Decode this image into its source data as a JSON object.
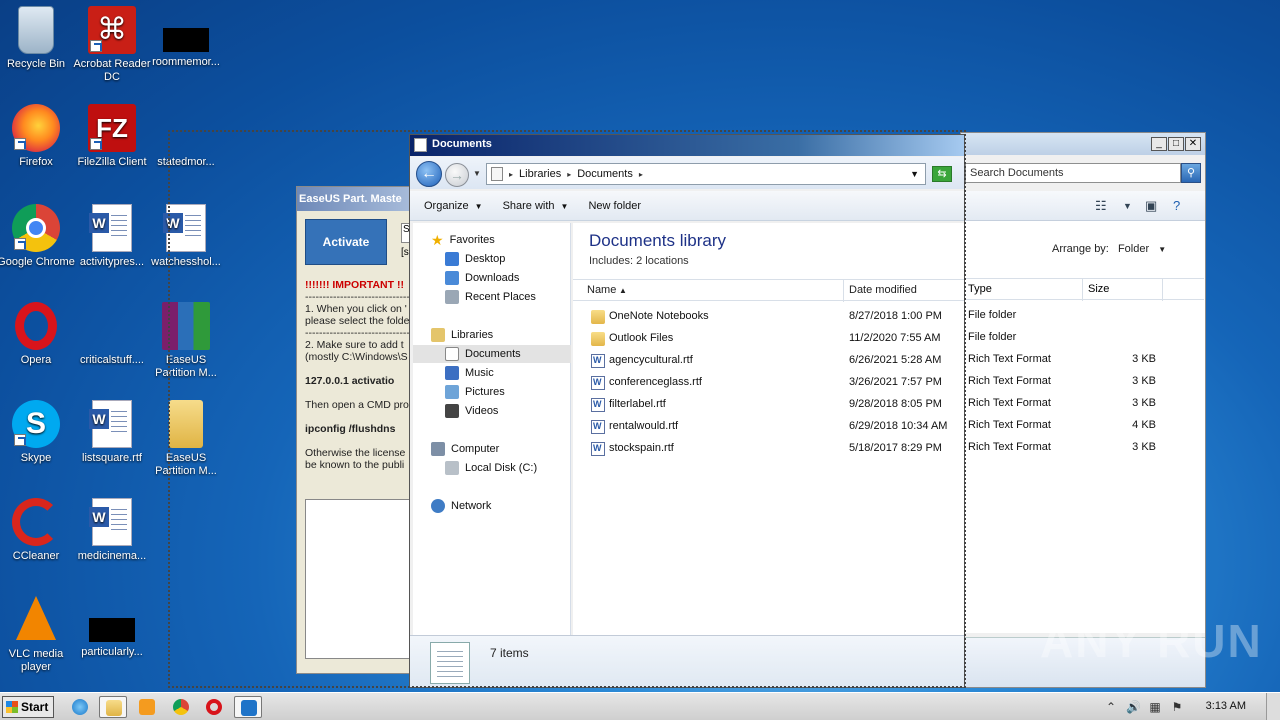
{
  "desktop": {
    "icons": [
      {
        "label": "Recycle Bin"
      },
      {
        "label": "Acrobat Reader DC"
      },
      {
        "label": "roommemor..."
      },
      {
        "label": "Firefox"
      },
      {
        "label": "FileZilla Client"
      },
      {
        "label": "statedmor..."
      },
      {
        "label": "Google Chrome"
      },
      {
        "label": "activitypres..."
      },
      {
        "label": "watchesshol..."
      },
      {
        "label": "Opera"
      },
      {
        "label": "criticalstuff...."
      },
      {
        "label": "EaseUS Partition M..."
      },
      {
        "label": "Skype"
      },
      {
        "label": "listsquare.rtf"
      },
      {
        "label": "EaseUS Partition M..."
      },
      {
        "label": "CCleaner"
      },
      {
        "label": "medicinema..."
      },
      {
        "label": "VLC media player"
      },
      {
        "label": "particularly..."
      }
    ]
  },
  "easeus": {
    "title": "EaseUS Part. Maste",
    "activate_label": "Activate",
    "field_text": "S",
    "field2_text": "[s",
    "important": "!!!!!!! IMPORTANT !!",
    "divider": "--------------------------------",
    "line1a": "1. When you click on '",
    "line1b": "please select the folde",
    "line2a": "2. Make sure to add t",
    "line2b": "(mostly C:\\Windows\\S",
    "ip_line": "127.0.0.1  activatio",
    "line3": "Then open a CMD pro",
    "flush": "ipconfig /flushdns",
    "line4a": "Otherwise the license",
    "line4b": "be known to the publi"
  },
  "behind": {
    "search_placeholder": "Search Documents",
    "search_icon": "magnifier-icon",
    "window_buttons": [
      "_",
      "□",
      "✕"
    ]
  },
  "explorer": {
    "title": "Documents",
    "breadcrumb": [
      "Libraries",
      "Documents"
    ],
    "commands": {
      "organize": "Organize",
      "share": "Share with",
      "new_folder": "New folder"
    },
    "nav": {
      "favorites": "Favorites",
      "desktop": "Desktop",
      "downloads": "Downloads",
      "recent": "Recent Places",
      "libraries": "Libraries",
      "documents": "Documents",
      "music": "Music",
      "pictures": "Pictures",
      "videos": "Videos",
      "computer": "Computer",
      "local_disk": "Local Disk (C:)",
      "network": "Network"
    },
    "library_title": "Documents library",
    "includes_label": "Includes:",
    "includes_value": "2 locations",
    "arrange_label": "Arrange by:",
    "arrange_value": "Folder",
    "columns": {
      "name": "Name",
      "date": "Date modified",
      "type": "Type",
      "size": "Size"
    },
    "files": [
      {
        "name": "OneNote Notebooks",
        "date": "8/27/2018 1:00 PM",
        "type": "File folder",
        "size": "",
        "kind": "folder"
      },
      {
        "name": "Outlook Files",
        "date": "11/2/2020 7:55 AM",
        "type": "File folder",
        "size": "",
        "kind": "folder"
      },
      {
        "name": "agencycultural.rtf",
        "date": "6/26/2021 5:28 AM",
        "type": "Rich Text Format",
        "size": "3 KB",
        "kind": "rtf"
      },
      {
        "name": "conferenceglass.rtf",
        "date": "3/26/2021 7:57 PM",
        "type": "Rich Text Format",
        "size": "3 KB",
        "kind": "rtf"
      },
      {
        "name": "filterlabel.rtf",
        "date": "9/28/2018 8:05 PM",
        "type": "Rich Text Format",
        "size": "3 KB",
        "kind": "rtf"
      },
      {
        "name": "rentalwould.rtf",
        "date": "6/29/2018 10:34 AM",
        "type": "Rich Text Format",
        "size": "4 KB",
        "kind": "rtf"
      },
      {
        "name": "stockspain.rtf",
        "date": "5/18/2017 8:29 PM",
        "type": "Rich Text Format",
        "size": "3 KB",
        "kind": "rtf"
      }
    ],
    "status": "7 items"
  },
  "watermark": "ANY RUN",
  "taskbar": {
    "start_label": "Start",
    "clock": "3:13 AM"
  }
}
